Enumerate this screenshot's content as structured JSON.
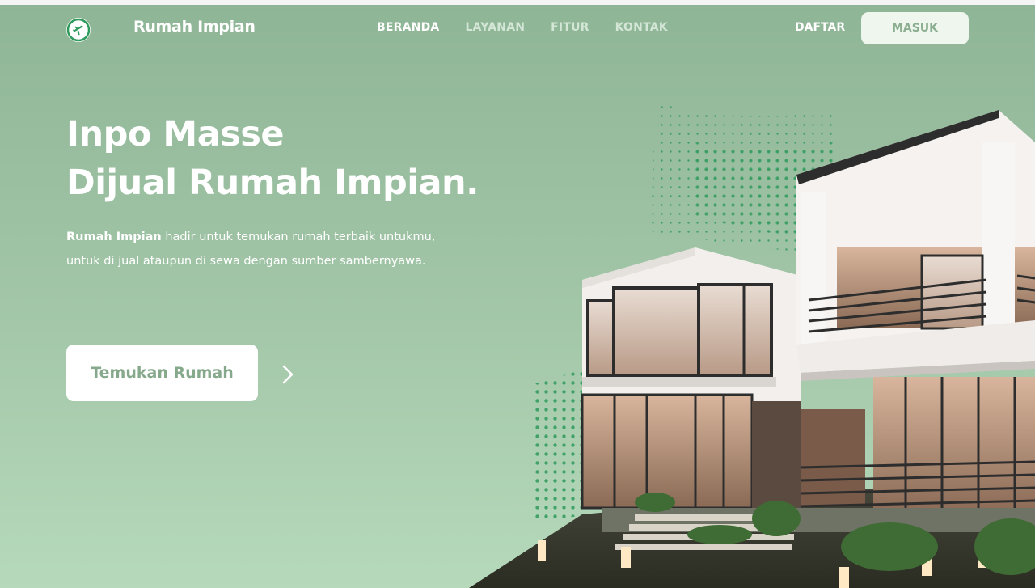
{
  "brand": {
    "name": "Rumah Impian",
    "logo_icon": "plane-icon"
  },
  "nav": {
    "items": [
      {
        "label": "BERANDA",
        "active": true
      },
      {
        "label": "LAYANAN",
        "active": false
      },
      {
        "label": "FITUR",
        "active": false
      },
      {
        "label": "KONTAK",
        "active": false
      }
    ],
    "register_label": "DAFTAR",
    "login_label": "MASUK"
  },
  "hero": {
    "headline_line1": "Inpo Masse",
    "headline_line2": "Dijual Rumah Impian.",
    "description_bold": "Rumah Impian",
    "description_rest": " hadir untuk temukan rumah terbaik untukmu, untuk di jual ataupun di sewa dengan sumber sambernyawa.",
    "cta_label": "Temukan Rumah",
    "next_icon": "chevron-right-icon"
  },
  "colors": {
    "hero_top": "#8fb597",
    "hero_bottom": "#b6d9bb",
    "accent_green": "#2e9a5c",
    "cta_text": "#86a98b"
  }
}
